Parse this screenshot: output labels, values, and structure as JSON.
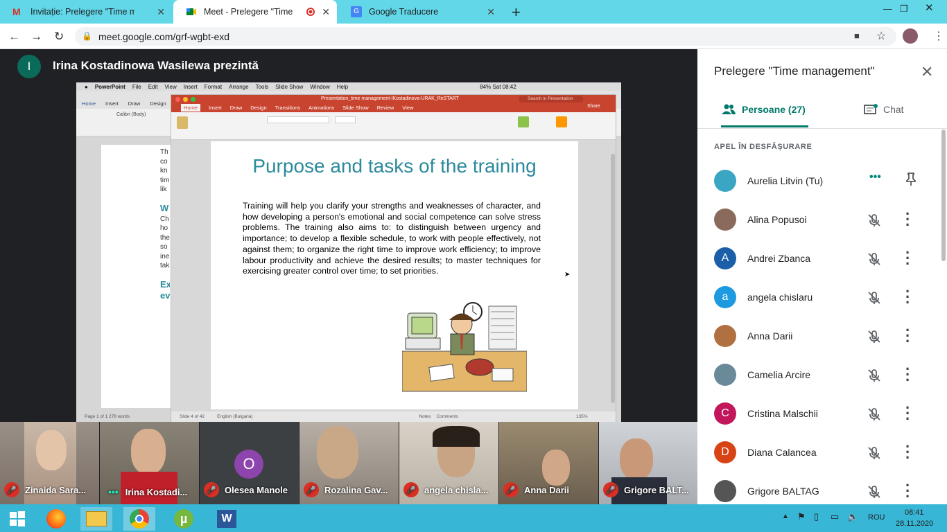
{
  "browser": {
    "tabs": [
      {
        "title": "Invitație: Prelegere \"Time manag"
      },
      {
        "title": "Meet - Prelegere \"Time man"
      },
      {
        "title": "Google Traducere"
      }
    ],
    "url": "meet.google.com/grf-wgbt-exd"
  },
  "meet": {
    "presenter_initial": "I",
    "presenter_label": "Irina Kostadinowa Wasilewa prezintă"
  },
  "shared_screen": {
    "mac_menu": [
      "PowerPoint",
      "File",
      "Edit",
      "View",
      "Insert",
      "Format",
      "Arrange",
      "Tools",
      "Slide Show",
      "Window",
      "Help"
    ],
    "mac_status": "84%  Sat 08:42",
    "ppt_window_title": "Presentation_time management-IKostadinova-URAK_ReSTART",
    "ppt_search": "Search in Presentation",
    "ppt_share": "Share",
    "ppt_tabs": [
      "Home",
      "Insert",
      "Draw",
      "Design",
      "Transitions",
      "Animations",
      "Slide Show",
      "Review",
      "View"
    ],
    "word_tabs": [
      "Home",
      "Insert",
      "Draw",
      "Design"
    ],
    "word_font": "Calibri (Body)",
    "word_status": "Page 1 of 1    278 words",
    "slide_title": "Purpose and tasks of the training",
    "slide_body": "Training will help you clarify your strengths and weaknesses of character, and how developing a person's emotional and social competence can solve stress problems. The training also aims to: to distinguish between urgency and importance; to develop a flexible schedule, to work with people effectively, not against them; to organize the right time to improve work efficiency; to improve labour productivity and achieve the desired results; to master techniques for exercising greater control over time; to set priorities.",
    "ppt_status_left": "Slide 4 of 42",
    "ppt_status_lang": "English (Bulgaria)",
    "ppt_notes": "Notes",
    "ppt_comments": "Comments",
    "ppt_zoom": "135%"
  },
  "videos": [
    {
      "name": "Zinaida Sara...",
      "muted": true
    },
    {
      "name": "Irina Kostadi...",
      "muted": false
    },
    {
      "name": "Olesea Manole",
      "muted": true,
      "initial": "O"
    },
    {
      "name": "Rozalina Gav...",
      "muted": true
    },
    {
      "name": "angela chisla...",
      "muted": true
    },
    {
      "name": "Anna Darii",
      "muted": true
    },
    {
      "name": "Grigore BALT...",
      "muted": true
    }
  ],
  "panel": {
    "title": "Prelegere \"Time management\"",
    "people_tab": "Persoane (27)",
    "chat_tab": "Chat",
    "section_label": "APEL ÎN DESFĂȘURARE",
    "participants": [
      {
        "name": "Aurelia Litvin (Tu)",
        "initial": "",
        "color": "#3aa6c4"
      },
      {
        "name": "Alina Popusoi",
        "initial": "",
        "color": "#8a6a5a"
      },
      {
        "name": "Andrei Zbanca",
        "initial": "A",
        "color": "#1a5fa8"
      },
      {
        "name": "angela chislaru",
        "initial": "a",
        "color": "#1e9ae0"
      },
      {
        "name": "Anna Darii",
        "initial": "",
        "color": "#b07040"
      },
      {
        "name": "Camelia Arcire",
        "initial": "",
        "color": "#6a8a9a"
      },
      {
        "name": "Cristina Malschii",
        "initial": "C",
        "color": "#c2185b"
      },
      {
        "name": "Diana Calancea",
        "initial": "D",
        "color": "#d84315"
      },
      {
        "name": "Grigore BALTAG",
        "initial": "",
        "color": "#555555"
      }
    ]
  },
  "taskbar": {
    "language": "ROU",
    "time": "08:41",
    "date": "28.11.2020"
  }
}
